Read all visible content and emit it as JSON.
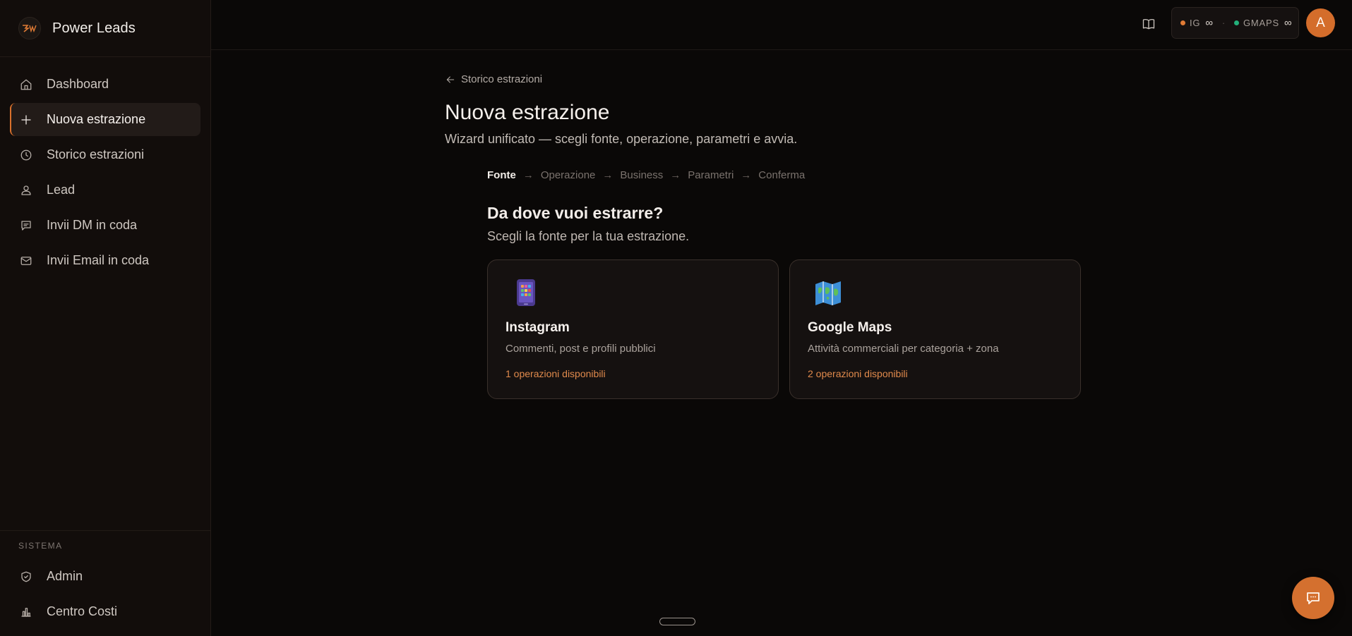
{
  "brand": {
    "name": "Power Leads"
  },
  "sidebar": {
    "items": [
      {
        "label": "Dashboard",
        "icon": "home-icon"
      },
      {
        "label": "Nuova estrazione",
        "icon": "plus-icon",
        "active": true
      },
      {
        "label": "Storico estrazioni",
        "icon": "clock-icon"
      },
      {
        "label": "Lead",
        "icon": "user-icon"
      },
      {
        "label": "Invii DM in coda",
        "icon": "message-icon"
      },
      {
        "label": "Invii Email in coda",
        "icon": "mail-icon"
      }
    ],
    "system": {
      "label": "SISTEMA",
      "items": [
        {
          "label": "Admin",
          "icon": "shield-icon"
        },
        {
          "label": "Centro Costi",
          "icon": "bar-chart-icon"
        }
      ]
    }
  },
  "topbar": {
    "quota": {
      "ig_label": "IG",
      "ig_value": "∞",
      "ig_color": "#e07b35",
      "separator": "·",
      "gmaps_label": "GMAPS",
      "gmaps_value": "∞",
      "gmaps_color": "#23b07a"
    },
    "avatar_initial": "A"
  },
  "main": {
    "back_link": "Storico estrazioni",
    "title": "Nuova estrazione",
    "subtitle": "Wizard unificato — scegli fonte, operazione, parametri e avvia.",
    "steps": [
      "Fonte",
      "Operazione",
      "Business",
      "Parametri",
      "Conferma"
    ],
    "steps_arrow": "→",
    "question_title": "Da dove vuoi estrarre?",
    "question_subtitle": "Scegli la fonte per la tua estrazione.",
    "cards": [
      {
        "title": "Instagram",
        "description": "Commenti, post e profili pubblici",
        "ops": "1 operazioni disponibili",
        "icon": "mobile-phone-icon"
      },
      {
        "title": "Google Maps",
        "description": "Attività commerciali per categoria + zona",
        "ops": "2 operazioni disponibili",
        "icon": "world-map-icon"
      }
    ]
  },
  "colors": {
    "accent": "#d9712c",
    "background": "#0a0807",
    "sidebar": "#120d0b"
  }
}
